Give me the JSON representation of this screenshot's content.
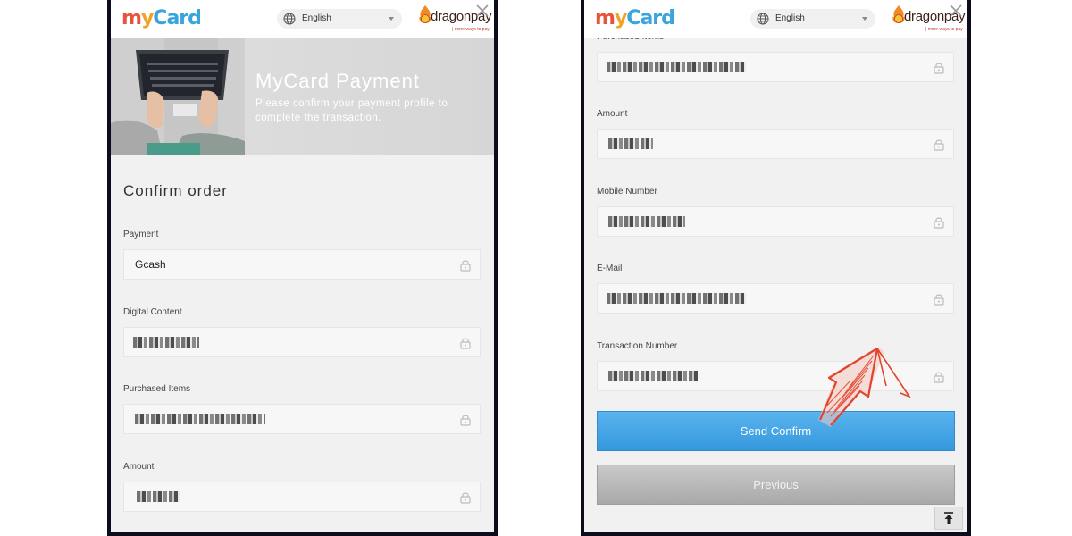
{
  "header": {
    "brand_mycard": "MyCard",
    "language": "English",
    "brand_dragonpay": "dragonpay",
    "dragonpay_tagline": "| more ways to pay"
  },
  "left_panel": {
    "hero_title": "MyCard Payment",
    "hero_subtitle": "Please confirm your payment profile to complete the transaction.",
    "section_title": "Confirm order",
    "fields": [
      {
        "label": "Payment",
        "value": "Gcash"
      },
      {
        "label": "Digital Content",
        "value": ""
      },
      {
        "label": "Purchased Items",
        "value": ""
      },
      {
        "label": "Amount",
        "value": ""
      }
    ]
  },
  "right_panel": {
    "fields": [
      {
        "label": "Purchased Items",
        "value": ""
      },
      {
        "label": "Amount",
        "value": ""
      },
      {
        "label": "Mobile Number",
        "value": ""
      },
      {
        "label": "E-Mail",
        "value": ""
      },
      {
        "label": "Transaction Number",
        "value": ""
      }
    ],
    "send_button": "Send Confirm",
    "previous_button": "Previous"
  },
  "icons": {
    "globe": "globe-icon",
    "lock": "lock-icon",
    "close": "close-icon",
    "back_to_top": "arrow-up-to-line-icon"
  },
  "colors": {
    "send_button": "#3a9ee4",
    "previous_button": "#b3b3b3",
    "annotation_arrow": "#e2432a"
  }
}
